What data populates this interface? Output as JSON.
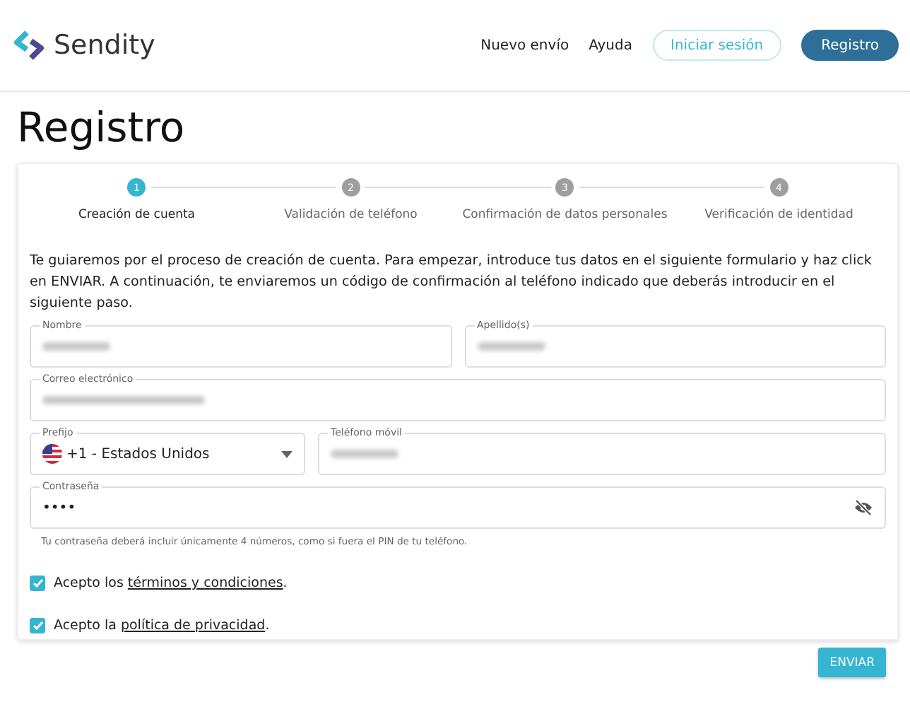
{
  "header": {
    "brand": "Sendity",
    "nav": [
      {
        "label": "Nuevo envío",
        "kind": "link"
      },
      {
        "label": "Ayuda",
        "kind": "link"
      },
      {
        "label": "Iniciar sesión",
        "kind": "outline"
      },
      {
        "label": "Registro",
        "kind": "filled"
      }
    ]
  },
  "page_title": "Registro",
  "stepper": [
    {
      "number": "1",
      "label": "Creación de cuenta",
      "selected": true
    },
    {
      "number": "2",
      "label": "Validación de teléfono",
      "selected": false
    },
    {
      "number": "3",
      "label": "Confirmación de datos personales",
      "selected": false
    },
    {
      "number": "4",
      "label": "Verificación de identidad",
      "selected": false
    }
  ],
  "intro": "Te guiaremos por el proceso de creación de cuenta. Para empezar, introduce tus datos en el siguiente formulario y haz click en ENVIAR. A continuación, te enviaremos un código de confirmación al teléfono indicado que deberás introducir en el siguiente paso.",
  "form_rows": [
    [
      {
        "label": "Nombre",
        "kind": "blurred"
      },
      {
        "label": "Apellido(s)",
        "kind": "blurred"
      }
    ],
    [
      {
        "label": "Correo electrónico",
        "kind": "blurred"
      }
    ],
    [
      {
        "label": "Prefijo",
        "kind": "select",
        "value": "+1 - Estados Unidos"
      },
      {
        "label": "Teléfono móvil",
        "kind": "blurred"
      }
    ],
    [
      {
        "label": "Contraseña",
        "kind": "password",
        "value": "••••"
      }
    ]
  ],
  "password_hint": "Tu contraseña deberá incluir únicamente 4 números, como si fuera el PIN de tu teléfono.",
  "agreements": [
    {
      "before": "Acepto los ",
      "link": "términos y condiciones",
      "after": ".",
      "checked": true
    },
    {
      "before": "Acepto la ",
      "link": "política de privacidad",
      "after": ".",
      "checked": true
    }
  ],
  "submit": "ENVIAR"
}
